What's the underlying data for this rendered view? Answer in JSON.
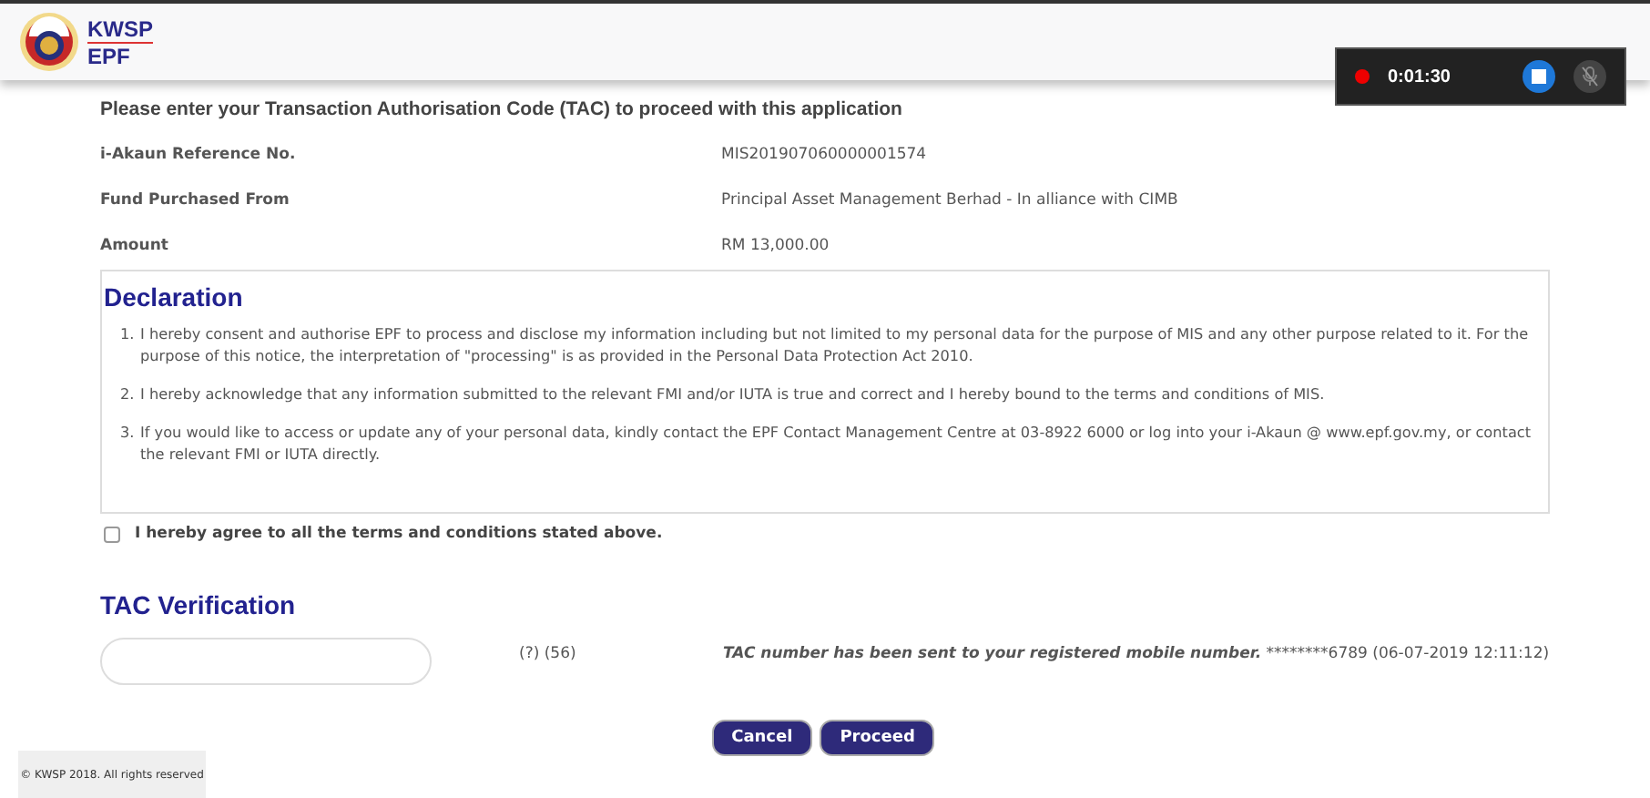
{
  "header": {
    "logo_top": "KWSP",
    "logo_bottom": "EPF"
  },
  "recorder": {
    "recording": true,
    "time": "0:01:30",
    "mic_muted": true
  },
  "instruction": "Please enter your Transaction Authorisation Code (TAC) to proceed with this application",
  "details": [
    {
      "label": "i-Akaun Reference No.",
      "value": "MIS201907060000001574"
    },
    {
      "label": "Fund Purchased From",
      "value": "Principal Asset Management Berhad - In alliance with CIMB"
    },
    {
      "label": "Amount",
      "value": "RM 13,000.00"
    }
  ],
  "declaration": {
    "title": "Declaration",
    "items": [
      {
        "marker": "1.",
        "text": "I hereby consent and authorise EPF to process and disclose my information including but not limited to my personal data for the purpose of MIS and any other purpose related to it. For the purpose of this notice, the interpretation of \"processing\" is as provided in the Personal Data Protection Act 2010."
      },
      {
        "marker": "2.",
        "text": "I hereby acknowledge that any information submitted to the relevant FMI and/or IUTA is true and correct and I hereby bound to the terms and conditions of MIS."
      },
      {
        "marker": "3.",
        "text": "If you would like to access or update any of your personal data, kindly contact the EPF Contact Management Centre at 03-8922 6000 or log into your i-Akaun @ www.epf.gov.my, or contact the relevant FMI or IUTA directly."
      }
    ]
  },
  "agree": {
    "label": "I hereby agree to all the terms and conditions stated above.",
    "checked": false
  },
  "tac": {
    "title": "TAC Verification",
    "counter": "(?) (56)",
    "message": "TAC number has been sent to your registered mobile number.",
    "detail": "********6789 (06-07-2019 12:11:12)"
  },
  "buttons": [
    {
      "label": "Cancel"
    },
    {
      "label": "Proceed"
    }
  ],
  "footer": "© KWSP 2018. All rights reserved"
}
